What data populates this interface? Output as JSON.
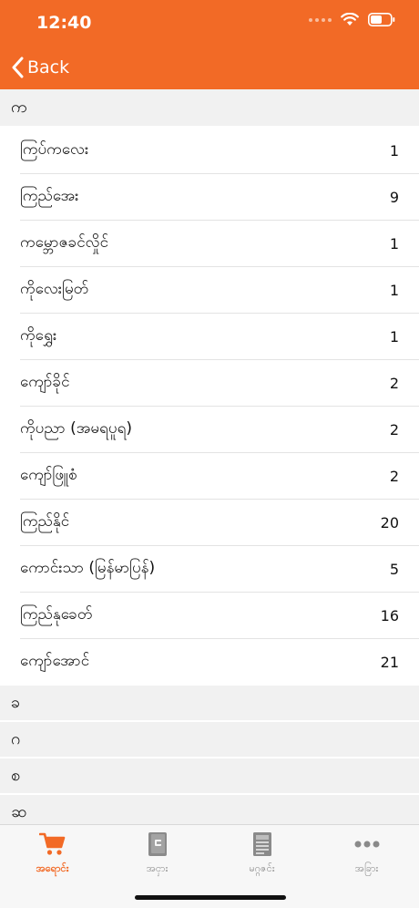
{
  "status_bar": {
    "time": "12:40"
  },
  "nav": {
    "back_label": "Back"
  },
  "colors": {
    "accent": "#f26a26",
    "section_bg": "#f1f1f1",
    "tab_inactive": "#8a8a8a"
  },
  "section_ka": {
    "title": "က",
    "items": [
      {
        "name": "ကြပ်ကလေး",
        "count": "1"
      },
      {
        "name": "ကြည်အေး",
        "count": "9"
      },
      {
        "name": "ကမ္ဘောဇခင်လှိုင်",
        "count": "1"
      },
      {
        "name": "ကိုလေးမြတ်",
        "count": "1"
      },
      {
        "name": "ကိုရွှေး",
        "count": "1"
      },
      {
        "name": "ကျော်ခိုင်",
        "count": "2"
      },
      {
        "name": "ကိုပညာ (အမရပူရ)",
        "count": "2"
      },
      {
        "name": "ကျော်ဖြူစံ",
        "count": "2"
      },
      {
        "name": "ကြည်နိုင်",
        "count": "20"
      },
      {
        "name": "ကောင်းသာ (မြန်မာပြန်)",
        "count": "5"
      },
      {
        "name": "ကြည်နုခေတ်",
        "count": "16"
      },
      {
        "name": "ကျော်အောင်",
        "count": "21"
      }
    ]
  },
  "other_sections": [
    "ခ",
    "ဂ",
    "စ",
    "ဆ"
  ],
  "tabs": [
    {
      "label": "အရောင်း",
      "icon": "cart-icon",
      "active": true
    },
    {
      "label": "အငှား",
      "icon": "book-icon",
      "active": false
    },
    {
      "label": "မဂ္ဂဇင်း",
      "icon": "magazine-icon",
      "active": false
    },
    {
      "label": "အခြား",
      "icon": "more-dots-icon",
      "active": false
    }
  ]
}
